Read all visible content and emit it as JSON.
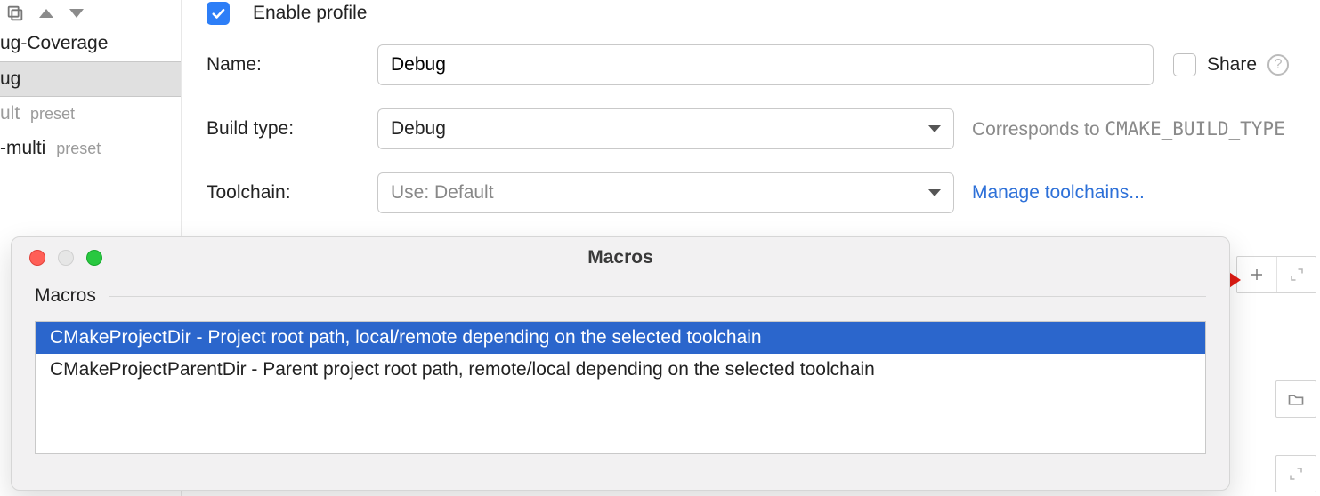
{
  "sidebar": {
    "items": [
      {
        "label": "ug-Coverage",
        "preset": ""
      },
      {
        "label": "ug",
        "preset": ""
      },
      {
        "label": "ult",
        "preset": "preset"
      },
      {
        "label": "-multi",
        "preset": "preset"
      }
    ]
  },
  "form": {
    "enable_label": "Enable profile",
    "name_label": "Name:",
    "name_value": "Debug",
    "share_label": "Share",
    "buildtype_label": "Build type:",
    "buildtype_value": "Debug",
    "buildtype_hint_prefix": "Corresponds to ",
    "buildtype_hint_var": "CMAKE_BUILD_TYPE",
    "toolchain_label": "Toolchain:",
    "toolchain_value": "Use: Default",
    "toolchain_link": "Manage toolchains..."
  },
  "dialog": {
    "title": "Macros",
    "section_label": "Macros",
    "items": [
      "CMakeProjectDir - Project root path, local/remote depending on the selected toolchain",
      "CMakeProjectParentDir - Parent project root path, remote/local depending on the selected toolchain"
    ]
  }
}
